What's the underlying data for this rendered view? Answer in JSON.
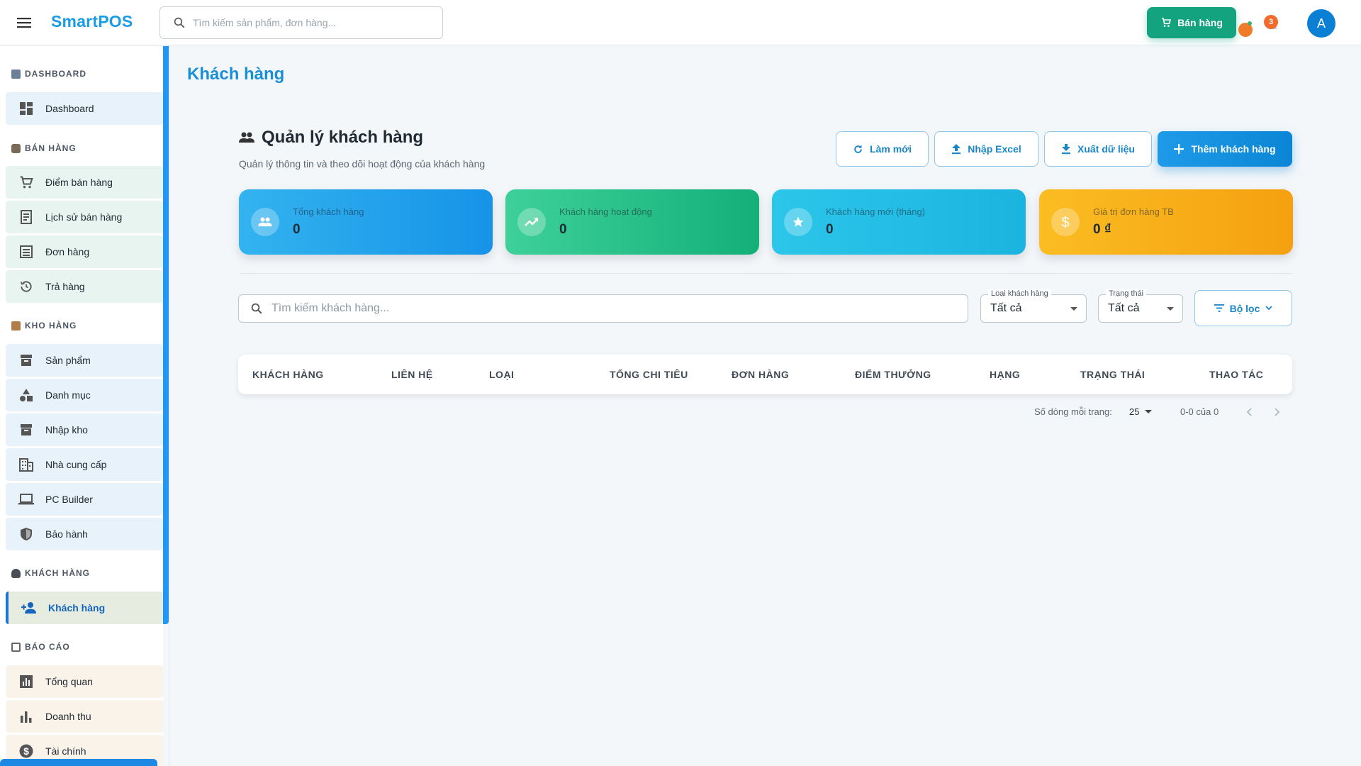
{
  "app": {
    "brand": "SmartPOS"
  },
  "topbar": {
    "search_placeholder": "Tìm kiếm sản phẩm, đơn hàng...",
    "sell_button": "Bán hàng",
    "notification_count": "3",
    "avatar_initial": "A"
  },
  "sidebar": {
    "sections": [
      {
        "title": "DASHBOARD",
        "items": [
          {
            "label": "Dashboard",
            "icon": "dashboard-icon"
          }
        ]
      },
      {
        "title": "BÁN HÀNG",
        "items": [
          {
            "label": "Điểm bán hàng",
            "icon": "cart-icon"
          },
          {
            "label": "Lịch sử bán hàng",
            "icon": "receipt-icon"
          },
          {
            "label": "Đơn hàng",
            "icon": "list-icon"
          },
          {
            "label": "Trả hàng",
            "icon": "history-icon"
          }
        ]
      },
      {
        "title": "KHO HÀNG",
        "items": [
          {
            "label": "Sản phẩm",
            "icon": "archive-icon"
          },
          {
            "label": "Danh mục",
            "icon": "category-icon"
          },
          {
            "label": "Nhập kho",
            "icon": "archive-icon"
          },
          {
            "label": "Nhà cung cấp",
            "icon": "building-icon"
          },
          {
            "label": "PC Builder",
            "icon": "laptop-icon"
          },
          {
            "label": "Bảo hành",
            "icon": "shield-icon"
          }
        ]
      },
      {
        "title": "KHÁCH HÀNG",
        "items": [
          {
            "label": "Khách hàng",
            "icon": "person-add-icon",
            "active": true
          }
        ]
      },
      {
        "title": "BÁO CÁO",
        "items": [
          {
            "label": "Tổng quan",
            "icon": "chart-icon"
          },
          {
            "label": "Doanh thu",
            "icon": "bar-chart-icon"
          },
          {
            "label": "Tài chính",
            "icon": "dollar-icon"
          }
        ]
      }
    ]
  },
  "page": {
    "title": "Khách hàng",
    "card_title": "Quản lý khách hàng",
    "card_subtitle": "Quản lý thông tin và theo dõi hoạt động của khách hàng",
    "buttons": {
      "refresh": "Làm mới",
      "import": "Nhập Excel",
      "export": "Xuất dữ liệu",
      "add": "Thêm khách hàng"
    },
    "stats": [
      {
        "label": "Tổng khách hàng",
        "value": "0",
        "icon": "people-icon",
        "color": "#1e9be8"
      },
      {
        "label": "Khách hàng hoạt động",
        "value": "0",
        "icon": "trending-up-icon",
        "color": "#20bb86"
      },
      {
        "label": "Khách hàng mới (tháng)",
        "value": "0",
        "icon": "star-icon",
        "color": "#22bde6"
      },
      {
        "label": "Giá trị đơn hàng TB",
        "value": "0 ₫",
        "icon": "dollar-icon",
        "color": "#f7aa16"
      }
    ],
    "search_placeholder": "Tìm kiếm khách hàng...",
    "filters": {
      "type_label": "Loại khách hàng",
      "type_value": "Tất cả",
      "status_label": "Trạng thái",
      "status_value": "Tất cả",
      "filter_button": "Bộ lọc"
    },
    "table": {
      "columns": [
        "KHÁCH HÀNG",
        "LIÊN HỆ",
        "LOẠI",
        "TỔNG CHI TIÊU",
        "ĐƠN HÀNG",
        "ĐIỂM THƯỞNG",
        "HẠNG",
        "TRẠNG THÁI",
        "THAO TÁC"
      ],
      "rows": []
    },
    "pagination": {
      "rows_per_page_label": "Số dòng mỗi trang:",
      "rows_per_page": "25",
      "range": "0-0 của 0"
    }
  }
}
